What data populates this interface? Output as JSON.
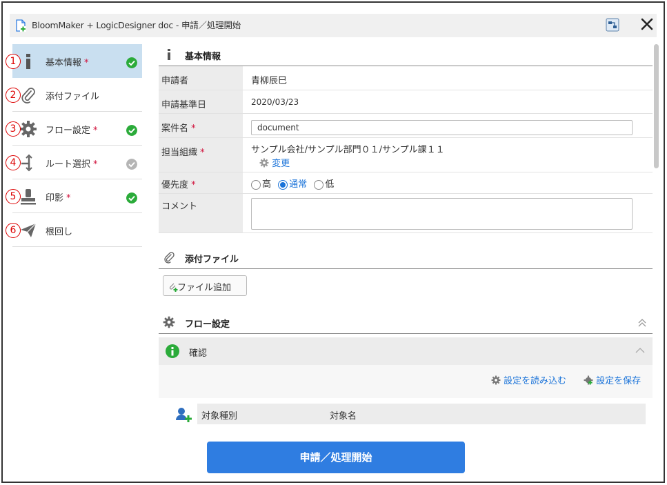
{
  "window": {
    "title": "BloomMaker + LogicDesigner doc - 申請／処理開始"
  },
  "sidebar": {
    "items": [
      {
        "num": "1",
        "label": "基本情報",
        "required": "*",
        "status": "complete",
        "icon": "info-icon"
      },
      {
        "num": "2",
        "label": "添付ファイル",
        "required": "",
        "status": "none",
        "icon": "paperclip-icon"
      },
      {
        "num": "3",
        "label": "フロー設定",
        "required": "*",
        "status": "complete",
        "icon": "gear-icon"
      },
      {
        "num": "4",
        "label": "ルート選択",
        "required": "*",
        "status": "pending",
        "icon": "route-icon"
      },
      {
        "num": "5",
        "label": "印影",
        "required": "*",
        "status": "complete",
        "icon": "stamp-icon"
      },
      {
        "num": "6",
        "label": "根回し",
        "required": "",
        "status": "none",
        "icon": "paper-plane-icon"
      }
    ]
  },
  "basic_info": {
    "heading": "基本情報",
    "applicant_label": "申請者",
    "applicant_value": "青柳辰巳",
    "date_label": "申請基準日",
    "date_value": "2020/03/23",
    "subject_label": "案件名",
    "subject_value": "document",
    "org_label": "担当組織",
    "org_value": "サンプル会社/サンプル部門０１/サンプル課１１",
    "org_change": "変更",
    "priority_label": "優先度",
    "priority_options": [
      "高",
      "通常",
      "低"
    ],
    "priority_selected": "通常",
    "comment_label": "コメント",
    "required_mark": "*"
  },
  "attachments": {
    "heading": "添付ファイル",
    "add_button": "ファイル追加"
  },
  "flow": {
    "heading": "フロー設定",
    "confirm_heading": "確認",
    "load_settings": "設定を読み込む",
    "save_settings": "設定を保存",
    "col_type": "対象種別",
    "col_name": "対象名"
  },
  "submit_label": "申請／処理開始",
  "colors": {
    "accent": "#2f7de1",
    "check_green": "#2bab3a",
    "check_gray": "#b5b5b5",
    "active_bg": "#c9dff0",
    "required": "#d0103a"
  }
}
